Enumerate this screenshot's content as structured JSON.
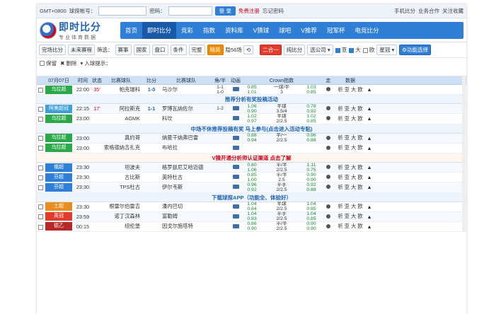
{
  "topbar": {
    "tz": "GMT+0800",
    "account_label": "球探帐号：",
    "password_label": "密码：",
    "login": "登 录",
    "register": "免费注册",
    "forgot": "忘记密码",
    "mobile": "手机比分",
    "biz": "业务合作",
    "favorite": "关注收藏"
  },
  "logo": {
    "title": "即时比分",
    "subtitle": "专业体育数据"
  },
  "nav": [
    "首页",
    "即时比分",
    "竞彩",
    "指数",
    "资料库",
    "V猜球",
    "球吧",
    "V推荐",
    "冠军杯",
    "电竞比分"
  ],
  "filters": {
    "complete": "完场比分",
    "upcoming": "未来赛程",
    "filter_label": "筛选：",
    "b1": "赛事",
    "b2": "国家",
    "b3": "盘口",
    "b4": "条件",
    "b5": "完整",
    "b6": "精简",
    "hidden": "隐56场",
    "combo": "二合一",
    "pure": "纯比分",
    "company": "选公司",
    "chk1": "亚",
    "chk2": "大",
    "chk3": "欧",
    "sort": "星冠",
    "func": "功能选择"
  },
  "toolbar": {
    "save": "保留",
    "delete": "删除",
    "enter_hint": "入球提示："
  },
  "headers": {
    "date": "07月07日",
    "time": "时间",
    "status": "状态",
    "home": "比赛球队",
    "score": "比分",
    "away": "比赛球队",
    "corner": "角/半",
    "anim": "动画",
    "crown": "Crown指数",
    "go": "走",
    "data": "数据"
  },
  "rows": [
    {
      "league": "乌拉超",
      "color": "#2aa84a",
      "time": "22:00",
      "status": "35'",
      "home": "帕克瑞科",
      "score": "1-0",
      "away": "马沙尔",
      "half": "1-1",
      "half2": "1-0",
      "o1": "0.85",
      "o2": "1.01",
      "h1": "一球/半",
      "h2": "3",
      "u1": "1.03",
      "u2": "0.85",
      "links": "析 亚 大 欧"
    },
    {
      "banner": "推荐分析有奖投稿活动",
      "type": "blue"
    },
    {
      "league": "阿美超冠",
      "color": "#3f9fd6",
      "time": "22:15",
      "status": "17'",
      "home": "阿拉斯克",
      "score": "1-1",
      "away": "罗博瓦纳佐尔",
      "half": "1-2",
      "half2": "",
      "o1": "1.06",
      "o2": "0.90",
      "h1": "半球",
      "h2": "3.5/4",
      "u1": "0.78",
      "u2": "0.92",
      "links": "析 亚 大 欧"
    },
    {
      "league": "乌拉超",
      "color": "#2aa84a",
      "time": "23:00",
      "status": "",
      "home": "AGMK",
      "score": "",
      "away": "科坎",
      "half": "",
      "half2": "",
      "o1": "1.02",
      "o2": "0.97",
      "h1": "半球",
      "h2": "2/2.5",
      "u1": "1.02",
      "u2": "0.85",
      "links": "析 亚 大 欧"
    },
    {
      "banner": "中场不休推荐投稿有奖 马上参与(点击进入活动专贴)",
      "type": "blue"
    },
    {
      "league": "乌拉超",
      "color": "#2aa84a",
      "time": "23:00",
      "status": "",
      "home": "真约哥",
      "score": "",
      "away": "纳曼干纳弗巴雷",
      "half": "",
      "half2": "",
      "o1": "0.88",
      "o2": "0.94",
      "h1": "半/一",
      "h2": "2/2.5",
      "u1": "0.96",
      "u2": "0.88",
      "links": "析 亚 大 欧"
    },
    {
      "league": "乌拉超",
      "color": "#2aa84a",
      "time": "23:00",
      "status": "",
      "home": "索格德纳吉扎克",
      "score": "",
      "away": "布哈拉",
      "half": "",
      "half2": "",
      "o1": "",
      "o2": "",
      "h1": "",
      "h2": "",
      "u1": "",
      "u2": "",
      "links": "析 亚 大 欧"
    },
    {
      "banner": "V猜开通分析师认证渠道 点击了解",
      "type": "red"
    },
    {
      "league": "俄超",
      "color": "#2f7fd6",
      "time": "23:30",
      "status": "",
      "home": "坦波夫",
      "score": "",
      "away": "格罗兹尼艾哈迈德",
      "half": "",
      "half2": "",
      "o1": "0.80",
      "o2": "1.06",
      "h1": "平/半",
      "h2": "2/2.5",
      "u1": "1.11",
      "u2": "0.75",
      "links": "析 亚 大 欧"
    },
    {
      "league": "芬超",
      "color": "#2f7fd6",
      "time": "23:30",
      "status": "",
      "home": "古比斯",
      "score": "",
      "away": "英特杜古",
      "half": "",
      "half2": "",
      "o1": "0.85",
      "o2": "1.00",
      "h1": "平/半",
      "h2": "2.5",
      "u1": "0.90",
      "u2": "0.90",
      "links": "析 亚 大 欧"
    },
    {
      "league": "芬超",
      "color": "#2f7fd6",
      "time": "23:30",
      "status": "",
      "home": "TPS杜古",
      "score": "",
      "away": "伊尔韦斯",
      "half": "",
      "half2": "",
      "o1": "0.96",
      "o2": "0.92",
      "h1": "平手",
      "h2": "2/2.5",
      "u1": "0.92",
      "u2": "0.88",
      "links": "析 亚 大 欧"
    },
    {
      "banner": "下载球探APP（功能全、体验好）",
      "type": "blue"
    },
    {
      "league": "土超",
      "color": "#e98d1e",
      "time": "23:30",
      "status": "",
      "home": "根雷尔伯雷吉",
      "score": "",
      "away": "潘内巴切",
      "half": "",
      "half2": "",
      "o1": "1.04",
      "o2": "0.84",
      "h1": "半球",
      "h2": "2/2.5",
      "u1": "1.04",
      "u2": "0.85",
      "links": "析 亚 大 欧"
    },
    {
      "league": "英冠",
      "color": "#e23b2e",
      "time": "23:59",
      "status": "",
      "home": "诺丁汉森林",
      "score": "",
      "away": "富勒姆",
      "half": "",
      "half2": "",
      "o1": "1.04",
      "o2": "0.83",
      "h1": "平手",
      "h2": "2/2.5",
      "u1": "1.04",
      "u2": "0.85",
      "links": "析 亚 大 欧"
    },
    {
      "league": "德乙",
      "color": "#b6282a",
      "time": "00:15",
      "status": "",
      "home": "纽伦堡",
      "score": "",
      "away": "因戈尔施塔特",
      "half": "",
      "half2": "",
      "o1": "0.86",
      "o2": "0.90",
      "h1": "平/半",
      "h2": "2/2.5",
      "u1": "0.90",
      "u2": "0.90",
      "links": "析 亚 大 欧"
    }
  ]
}
